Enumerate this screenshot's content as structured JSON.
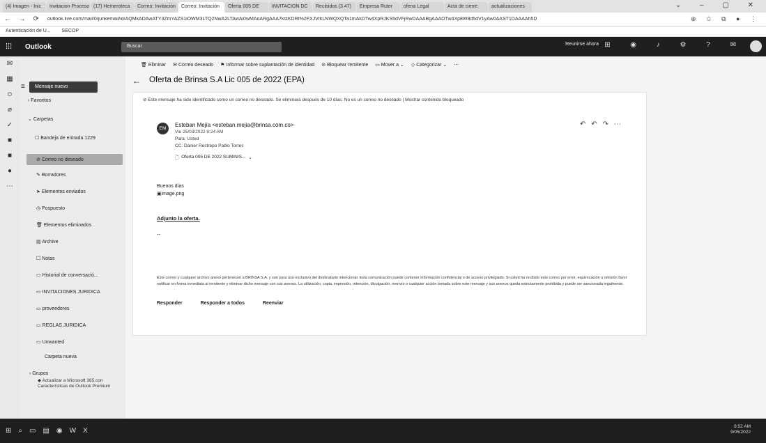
{
  "browser": {
    "tabs": [
      "(4) Imagen - Inic",
      "Invitacion Proceso",
      "(17) Hemeroteca",
      "Correo: Invitación",
      "Correo: Invitación",
      "Oferta 005 DE",
      "INVITACION DC",
      "Recibidos (3.47)",
      "Empresa Ruter",
      "ofena Legal",
      "Acta de cierre",
      "actualizaciones"
    ],
    "active_tab": "Correo: Invitación",
    "url": "outlook.live.com/mail/0/junkemail/id/AQMkADAwATY3ZmYAZS1iOWM3LTQ2NwA2LTAwAi0wMAoARgAAA7kstKDRt%2FXJVrkLNWQXQTa1mAkDTw4XpRJKS5dVFjRwDAAABgAAAOTw4Xp8W8d5dV1yAw0AAST1DAAAAh5D",
    "bookmarks": [
      "Autenticación de U...",
      "SECOP"
    ]
  },
  "outlook": {
    "app_name": "Outlook",
    "search_placeholder": "Buscar",
    "top_right_text": "Reunirse ahora",
    "new_mail": "Mensaje nuevo",
    "folders": {
      "favoritos": "Favoritos",
      "carpetas": "Carpetas",
      "inbox": "Bandeja de entrada",
      "inbox_count": "1229",
      "junk": "Correo no deseado",
      "drafts": "Borradores",
      "sent": "Elementos enviados",
      "scheduled": "Pospuesto",
      "deleted": "Elementos eliminados",
      "archive": "Archive",
      "notes": "Notas",
      "history": "Historial de conversació...",
      "invitaciones": "INVITACIONES JURIDICA",
      "proveedores": "proveedores",
      "reglas": "REGLAS JURIDICA",
      "unwanted": "Unwanted",
      "new_folder": "Carpeta nueva",
      "grupos": "Grupos"
    },
    "promo": "Actualizar a Microsoft 365 con Características de Outlook Premium",
    "toolbar": {
      "delete": "Eliminar",
      "junk": "Correo deseado",
      "report": "Informar sobre suplantación de identidad",
      "block": "Bloquear remitente",
      "move": "Mover a",
      "categorize": "Categorizar"
    },
    "message": {
      "subject": "Oferta de Brinsa S.A Lic 005 de 2022 (EPA)",
      "junk_note": "Este mensaje ha sido identificado como un correo no deseado. Se eliminará después de 10 días. No es un correo no deseado | Mostrar contenido bloqueado",
      "avatar_initials": "EM",
      "sender": "Esteban Mejía <esteban.mejia@brinsa.com.co>",
      "date": "Vie 25/03/2022 8:24 AM",
      "to": "Para: Usted",
      "cc": "CC: Danier Restrepo Pablo Torres",
      "attachment": "Oferta 005 DE 2022 SUMINIS...",
      "greeting": "Buenos días",
      "image_name": "image.png",
      "adjunto": "Adjunto la oferta.",
      "dash": "--",
      "disclaimer": "Este correo y cualquier archivo anexo pertenecen a BRINSA S.A. y son para uso exclusivo del destinatario intencional. Esta comunicación puede contener información confidencial o de acceso privilegiado. Si usted ha recibido este correo por error, equivocación u omisión favor notificar en forma inmediata al remitente y eliminar dicho mensaje con sus anexos. La utilización, copia, impresión, retención, divulgación, reenvío o cualquier acción tomada sobre este mensaje y sus anexos queda estrictamente prohibida y puede ser sancionada legalmente.",
      "reply": "Responder",
      "reply_all": "Responder a todos",
      "forward": "Reenviar"
    }
  },
  "taskbar": {
    "time": "8:52 AM",
    "date": "9/05/2022"
  }
}
